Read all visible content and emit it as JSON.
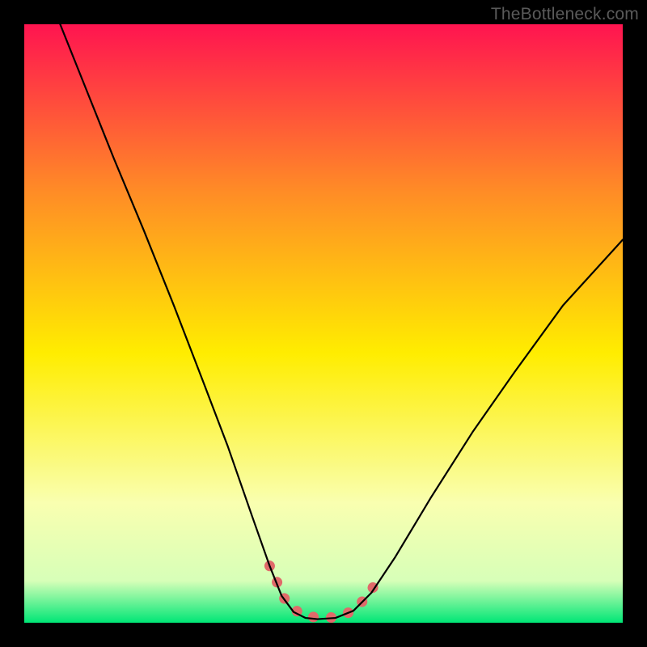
{
  "watermark": "TheBottleneck.com",
  "chart_data": {
    "type": "line",
    "title": "",
    "xlabel": "",
    "ylabel": "",
    "xlim": [
      0,
      100
    ],
    "ylim": [
      0,
      100
    ],
    "background_gradient": {
      "top": "#ff1450",
      "upper_mid": "#ff8c26",
      "mid": "#ffed00",
      "lower_mid": "#f9ffb0",
      "bottom": "#00e676"
    },
    "series": [
      {
        "name": "bottleneck-curve",
        "stroke": "#000000",
        "stroke_width": 2.2,
        "points": [
          {
            "x": 6.0,
            "y": 100.0
          },
          {
            "x": 10.0,
            "y": 90.0
          },
          {
            "x": 15.0,
            "y": 77.5
          },
          {
            "x": 20.0,
            "y": 65.5
          },
          {
            "x": 25.0,
            "y": 53.0
          },
          {
            "x": 30.0,
            "y": 40.0
          },
          {
            "x": 34.0,
            "y": 29.5
          },
          {
            "x": 38.0,
            "y": 18.0
          },
          {
            "x": 41.0,
            "y": 9.5
          },
          {
            "x": 43.0,
            "y": 4.5
          },
          {
            "x": 45.0,
            "y": 1.8
          },
          {
            "x": 47.0,
            "y": 0.8
          },
          {
            "x": 49.0,
            "y": 0.6
          },
          {
            "x": 52.0,
            "y": 0.8
          },
          {
            "x": 55.0,
            "y": 2.0
          },
          {
            "x": 58.0,
            "y": 5.0
          },
          {
            "x": 62.0,
            "y": 11.0
          },
          {
            "x": 68.0,
            "y": 21.0
          },
          {
            "x": 75.0,
            "y": 32.0
          },
          {
            "x": 82.0,
            "y": 42.0
          },
          {
            "x": 90.0,
            "y": 53.0
          },
          {
            "x": 100.0,
            "y": 64.0
          }
        ]
      },
      {
        "name": "highlight-segment",
        "stroke": "#e06a6a",
        "stroke_width": 13,
        "linecap": "round",
        "points": [
          {
            "x": 41.0,
            "y": 9.5
          },
          {
            "x": 43.5,
            "y": 4.0
          },
          {
            "x": 46.0,
            "y": 1.5
          },
          {
            "x": 49.0,
            "y": 0.8
          },
          {
            "x": 52.0,
            "y": 0.9
          },
          {
            "x": 54.5,
            "y": 1.8
          },
          {
            "x": 57.0,
            "y": 4.0
          },
          {
            "x": 59.0,
            "y": 7.0
          }
        ]
      }
    ]
  }
}
